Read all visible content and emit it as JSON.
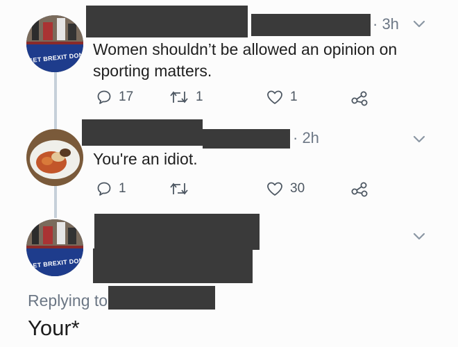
{
  "tweets": [
    {
      "time": "· 3h",
      "text": "Women shouldn’t be allowed an opinion on sporting matters.",
      "avatar_banner": "GET BREXIT DONE",
      "replies": "17",
      "retweets": "1",
      "likes": "1"
    },
    {
      "time": "· 2h",
      "text": "You're an idiot.",
      "replies": "1",
      "retweets": "",
      "likes": "30"
    },
    {
      "avatar_banner": "GET BREXIT DONE"
    }
  ],
  "reply": {
    "replying_label": "Replying to",
    "text": "Your*"
  },
  "colors": {
    "redaction": "#3a3a3a",
    "thread_line": "#c6d0d9",
    "muted_text": "#6c7785"
  },
  "icons": [
    "chevron-down-icon",
    "reply-icon",
    "retweet-icon",
    "like-icon",
    "share-icon"
  ]
}
